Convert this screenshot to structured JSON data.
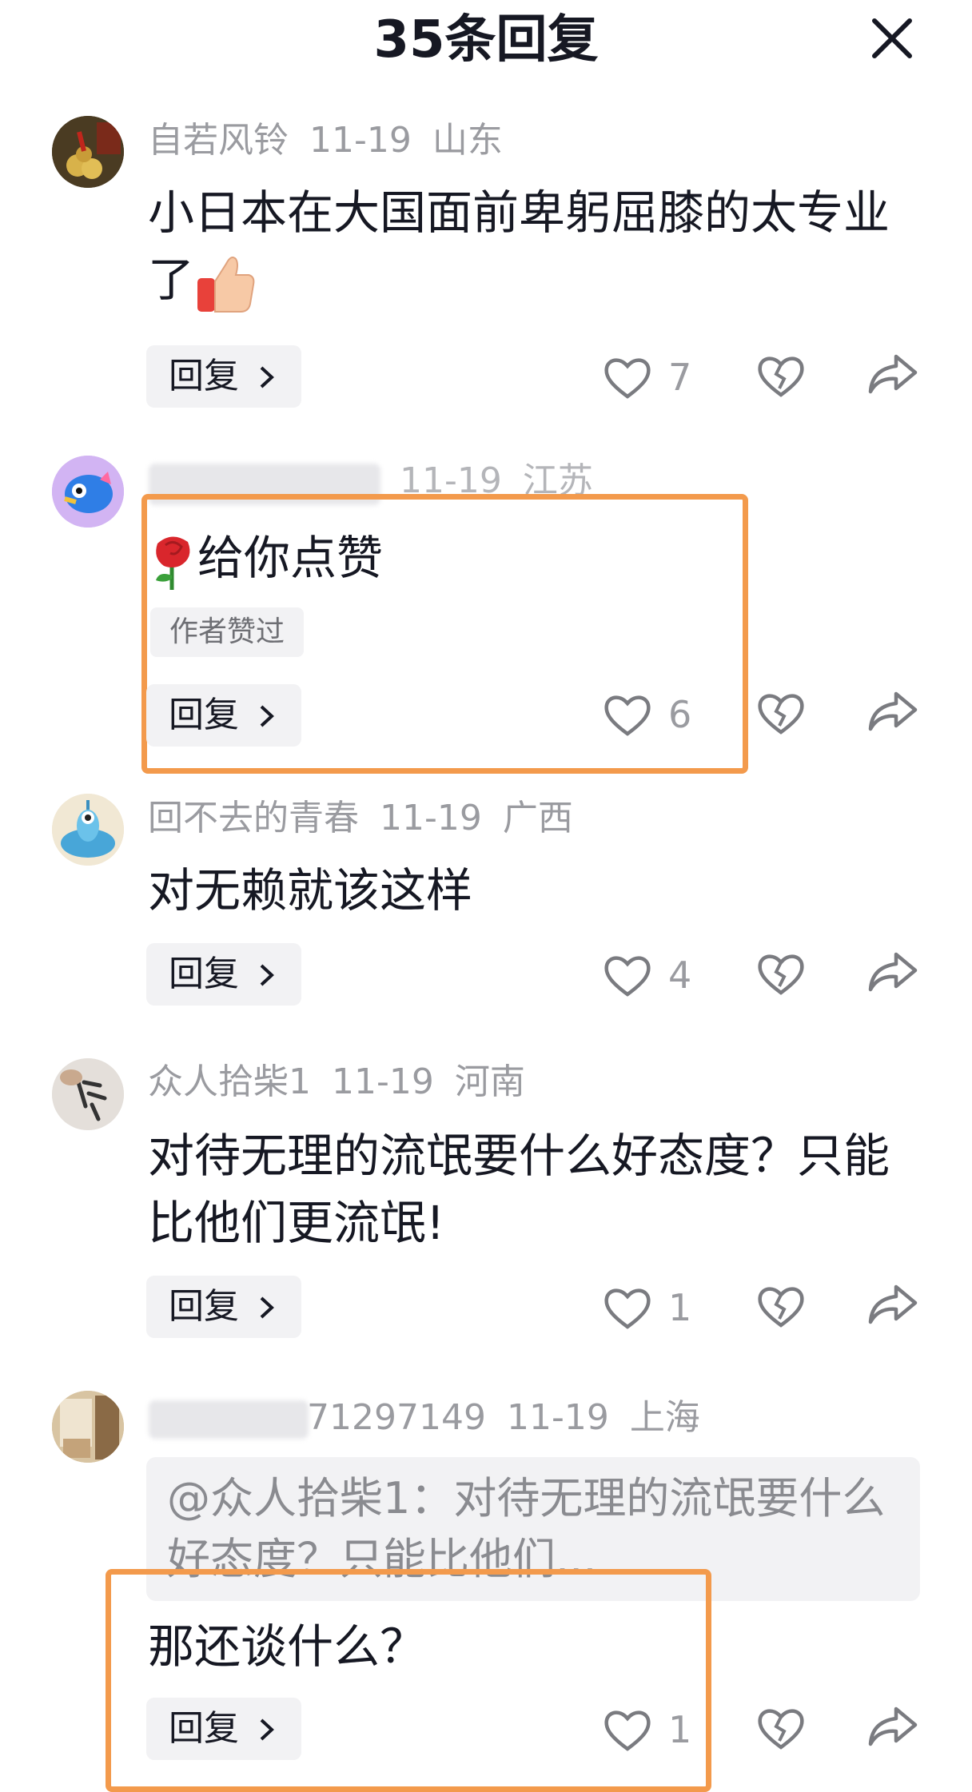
{
  "header": {
    "title": "35条回复"
  },
  "comments": [
    {
      "user": "自若风铃",
      "date": "11-19",
      "location": "山东",
      "text": "小日本在大国面前卑躬屈膝的太专业了",
      "reply_label": "回复",
      "likes": "7"
    },
    {
      "user": "",
      "date": "11-19",
      "location": "江苏",
      "text": "给你点赞",
      "badge": "作者赞过",
      "reply_label": "回复",
      "likes": "6"
    },
    {
      "user": "回不去的青春",
      "date": "11-19",
      "location": "广西",
      "text": "对无赖就该这样",
      "reply_label": "回复",
      "likes": "4"
    },
    {
      "user": "众人拾柴1",
      "date": "11-19",
      "location": "河南",
      "text": "对待无理的流氓要什么好态度？只能比他们更流氓!",
      "reply_label": "回复",
      "likes": "1"
    },
    {
      "user": "71297149",
      "date": "11-19",
      "location": "上海",
      "quote": "@众人拾柴1：对待无理的流氓要什么好态度？只能比他们...",
      "text": "那还谈什么？",
      "reply_label": "回复",
      "likes": "1"
    }
  ],
  "colors": {
    "highlight": "#f39a4c",
    "meta_text": "#9a9ba0",
    "chip_bg": "#f2f2f4"
  },
  "icons": [
    "close-icon",
    "heart-icon",
    "broken-heart-icon",
    "share-arrow-icon",
    "thumbs-up-emoji",
    "rose-emoji",
    "chevron-right-icon"
  ]
}
